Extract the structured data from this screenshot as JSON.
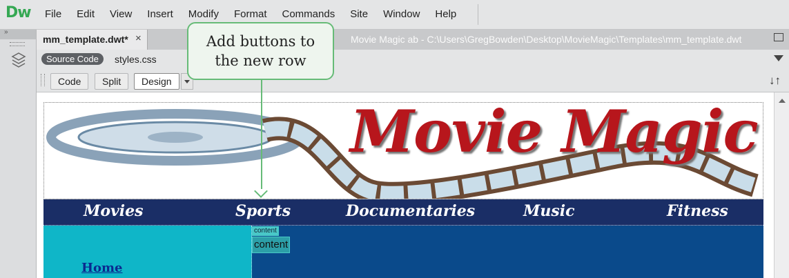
{
  "app": {
    "logo": "Dw"
  },
  "menu": [
    "File",
    "Edit",
    "View",
    "Insert",
    "Modify",
    "Format",
    "Commands",
    "Site",
    "Window",
    "Help"
  ],
  "panel": {
    "collapse_glyph": "»"
  },
  "document": {
    "tab_name": "mm_template.dwt*",
    "close_glyph": "×",
    "path": "Movie Magic ab - C:\\Users\\GregBowden\\Desktop\\MovieMagic\\Templates\\mm_template.dwt"
  },
  "related_files": {
    "source": "Source Code",
    "css": "styles.css"
  },
  "view_buttons": {
    "code": "Code",
    "split": "Split",
    "design": "Design"
  },
  "toolbar_icons": {
    "sort": "↓↑"
  },
  "page": {
    "banner_title": "Movie Magic",
    "nav": [
      "Movies",
      "Sports",
      "Documentaries",
      "Music",
      "Fitness"
    ],
    "home_link": "Home",
    "editable_tag": "content",
    "editable_region": "content"
  },
  "callout": {
    "line1": "Add buttons to",
    "line2": "the new row"
  },
  "colors": {
    "nav_bg": "#1a2e66",
    "content_bg": "#0a4a8b",
    "sidebar_bg": "#0fb6c8",
    "callout_border": "#66bb77"
  }
}
